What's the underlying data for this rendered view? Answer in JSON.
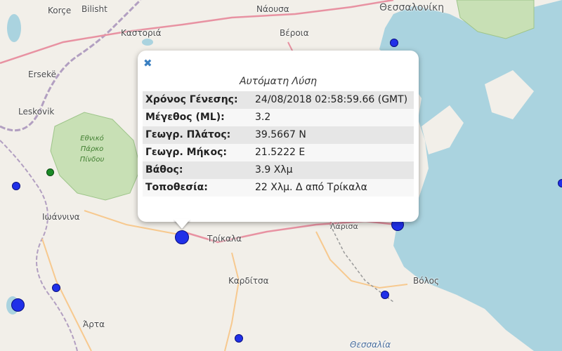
{
  "places": {
    "korce": "Korçe",
    "bilisht": "Bilisht",
    "naousa": "Νάουσα",
    "thessaloniki": "Θεσσαλονίκη",
    "kastoria": "Καστοριά",
    "veroia": "Βέροια",
    "ersek": "Ersekë",
    "leskovik": "Leskovik",
    "ioannina": "Ιωάννινα",
    "trikala": "Τρίκαλα",
    "karditsa": "Καρδίτσα",
    "volos": "Βόλος",
    "arta": "Άρτα",
    "thessalia": "Θεσσαλία",
    "larisa_partial": "Λάρισα"
  },
  "park": {
    "line1": "Εθνικό",
    "line2": "Πάρκο",
    "line3": "Πίνδου"
  },
  "popup": {
    "close_glyph": "✖",
    "title": "Αυτόματη Λύση",
    "rows": [
      {
        "label": "Χρόνος Γένεσης:",
        "value": "24/08/2018 02:58:59.66 (GMT)"
      },
      {
        "label": "Μέγεθος (ML):",
        "value": "3.2"
      },
      {
        "label": "Γεωγρ. Πλάτος:",
        "value": "39.5667 N"
      },
      {
        "label": "Γεωγρ. Μήκος:",
        "value": "21.5222 E"
      },
      {
        "label": "Βάθος:",
        "value": "3.9 Χλμ"
      },
      {
        "label": "Τοποθεσία:",
        "value": "22 Χλμ. Δ από Τρίκαλα"
      }
    ]
  },
  "colors": {
    "quake_marker": "#2030e8",
    "station_marker": "#1b8a26",
    "sea": "#aad3df",
    "park": "#c8e0b5",
    "land": "#f2efe9"
  },
  "icons": {
    "close": "close-icon",
    "quake": "earthquake-marker",
    "station": "station-marker"
  }
}
